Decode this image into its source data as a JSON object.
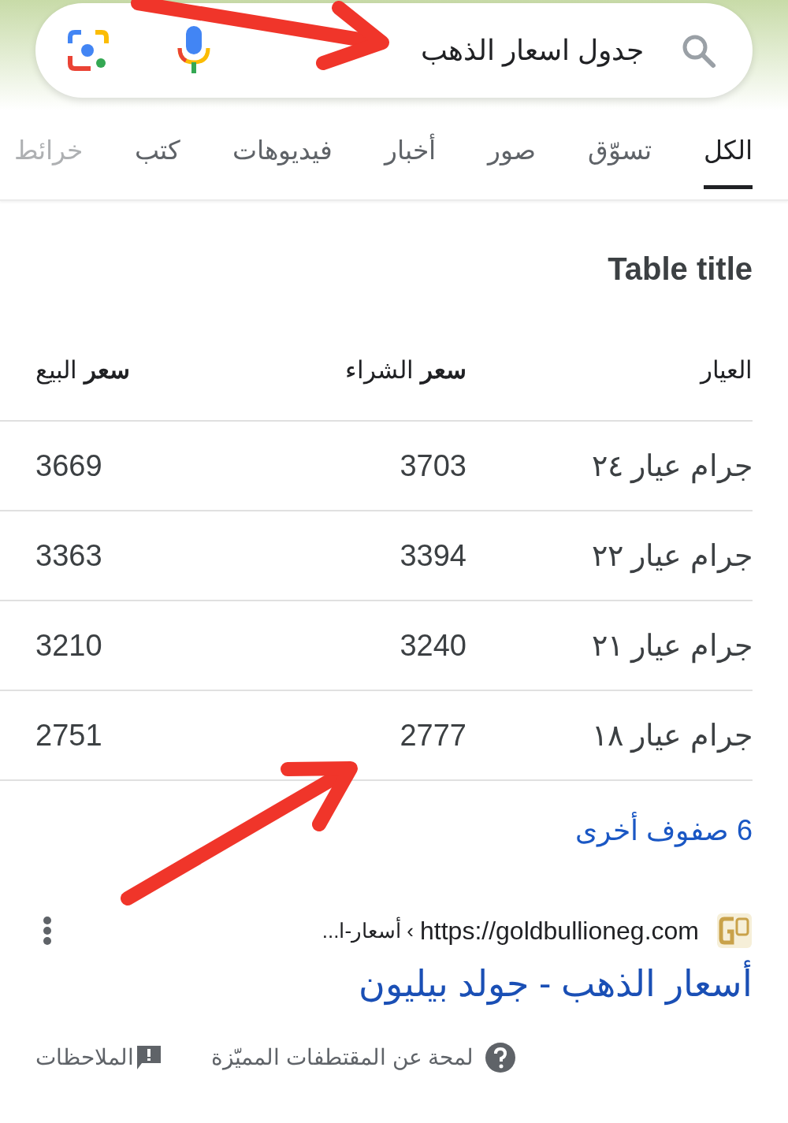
{
  "search": {
    "value": "جدول اسعار الذهب"
  },
  "tabs": [
    {
      "label": "الكل",
      "selected": true
    },
    {
      "label": "تسوّق",
      "selected": false
    },
    {
      "label": "صور",
      "selected": false
    },
    {
      "label": "أخبار",
      "selected": false
    },
    {
      "label": "فيديوهات",
      "selected": false
    },
    {
      "label": "كتب",
      "selected": false
    },
    {
      "label": "خرائط",
      "selected": false
    }
  ],
  "table": {
    "title": "Table title",
    "columns": [
      "العيار",
      "**سعر** الشراء",
      "**سعر** البيع"
    ],
    "rows": [
      [
        "جرام عيار ٢٤",
        "3703",
        "3669"
      ],
      [
        "جرام عيار ٢٢",
        "3394",
        "3363"
      ],
      [
        "جرام عيار ٢١",
        "3240",
        "3210"
      ],
      [
        "جرام عيار ١٨",
        "2777",
        "2751"
      ]
    ],
    "more_rows_link": "6 صفوف أخرى"
  },
  "result": {
    "url": "https://goldbullioneg.com",
    "breadcrumb": "› أسعار-ا...",
    "title": "أسعار الذهب - جولد بيليون"
  },
  "footer": {
    "about": "لمحة عن المقتطفات المميّزة",
    "feedback": "الملاحظات"
  }
}
